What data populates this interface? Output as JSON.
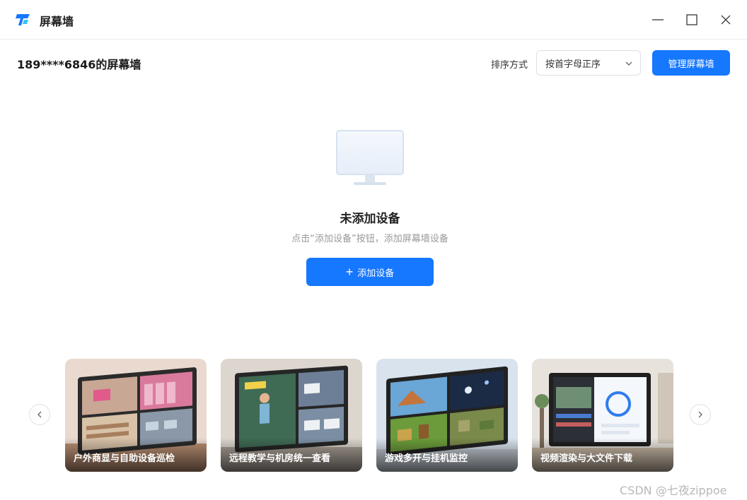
{
  "window": {
    "title": "屏幕墙",
    "controls": {
      "minimize_icon": "minimize-icon",
      "maximize_icon": "maximize-icon",
      "close_icon": "close-icon"
    }
  },
  "header": {
    "owner_title": "189****6846的屏幕墙",
    "sort_label": "排序方式",
    "sort_selected": "按首字母正序",
    "manage_label": "管理屏幕墙"
  },
  "empty_state": {
    "title": "未添加设备",
    "hint": "点击“添加设备”按钮，添加屏幕墙设备",
    "add_label": "添加设备"
  },
  "carousel": {
    "cards": [
      {
        "caption": "户外商显与自助设备巡检"
      },
      {
        "caption": "远程教学与机房统一查看"
      },
      {
        "caption": "游戏多开与挂机监控"
      },
      {
        "caption": "视频渲染与大文件下载"
      }
    ]
  },
  "watermark": "CSDN @七夜zippoe",
  "colors": {
    "accent": "#1677ff",
    "border": "#dcdfe6",
    "muted_text": "#999999"
  }
}
